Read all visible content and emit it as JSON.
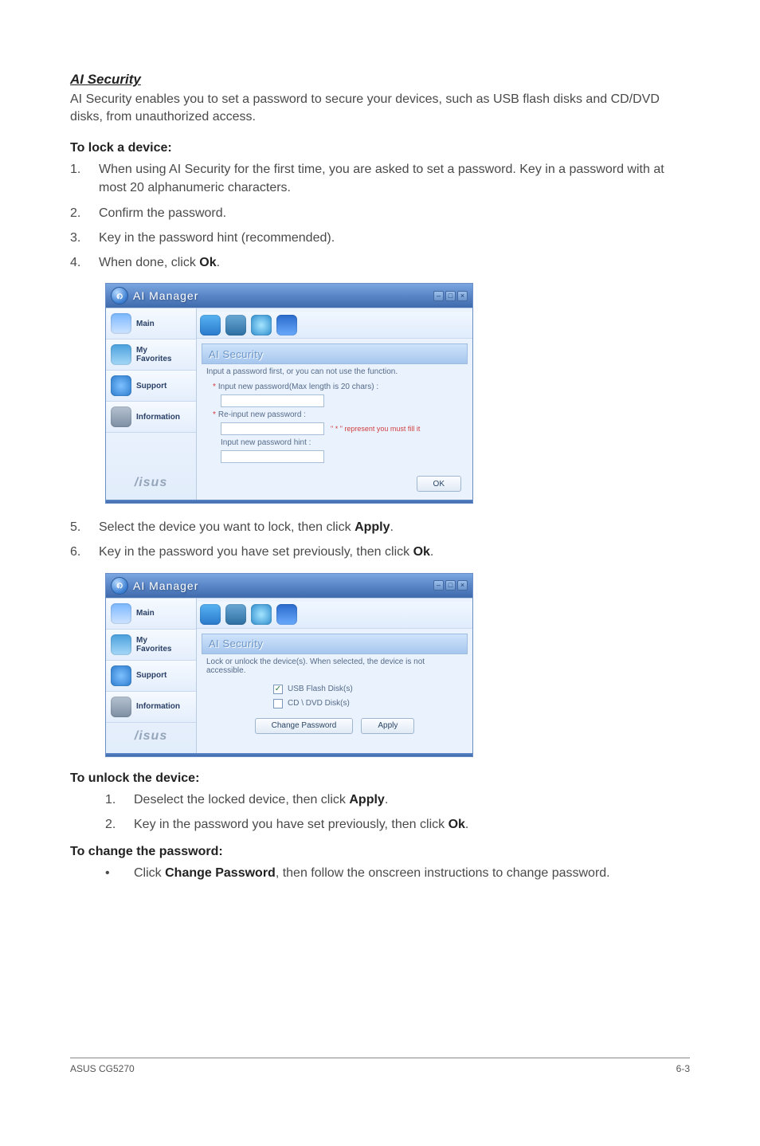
{
  "ai_security": {
    "heading": "AI Security",
    "intro1": "AI Security enables you to set a password to secure your devices, such as USB flash disks and CD/DVD disks, from unauthorized access.",
    "lock_head": "To lock a device:",
    "steps_lock": [
      "When using AI Security for the first time, you are asked to set a password. Key in a password with at most 20 alphanumeric characters.",
      "Confirm the password.",
      "Key in the password hint (recommended).",
      "When done, click "
    ],
    "ok_word": "Ok",
    "steps_lock_continue": [
      "Select the device you want to lock, then click ",
      "Key in the password you have set previously, then click "
    ],
    "apply_word": "Apply",
    "unlock_head": "To unlock the device:",
    "steps_unlock": [
      "Deselect the locked device, then click ",
      "Key in the password you have set previously, then click "
    ],
    "changepw_head": "To change the password:",
    "changepw_bullet_prefix": "Click ",
    "changepw_bold": "Change Password",
    "changepw_bullet_suffix": ", then follow the onscreen instructions to change password."
  },
  "aim": {
    "title": "AI Manager",
    "side": {
      "main": "Main",
      "fav": "My\nFavorites",
      "support": "Support",
      "info": "Information",
      "brand": "/isus"
    },
    "content1": {
      "title": "AI Security",
      "desc": "Input a password first, or you can not use the function.",
      "row1": "Input new password(Max length is 20 chars) :",
      "row2": "Re-input new password :",
      "row2hint": "\" * \" represent you must fill it",
      "row3": "Input new password hint :",
      "ok": "OK"
    },
    "content2": {
      "title": "AI Security",
      "desc": "Lock or unlock the device(s). When selected, the device is not accessible.",
      "usb": "USB Flash Disk(s)",
      "cd": "CD \\ DVD Disk(s)",
      "changepw": "Change Password",
      "apply": "Apply"
    }
  },
  "footer": {
    "left": "ASUS CG5270",
    "right": "6-3"
  }
}
